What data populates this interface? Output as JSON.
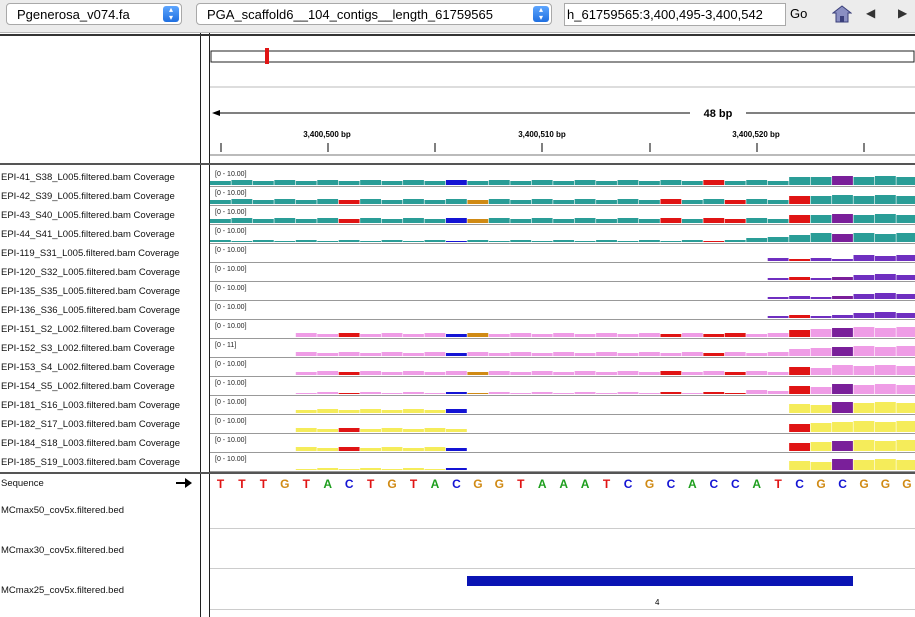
{
  "toolbar": {
    "genome": "Pgenerosa_v074.fa",
    "chromosome": "PGA_scaffold6__104_contigs__length_61759565",
    "locus": "h_61759565:3,400,495-3,400,542",
    "go_label": "Go",
    "home_icon": "home-icon",
    "back_icon": "back-arrow-icon",
    "forward_icon": "forward-arrow-icon"
  },
  "ruler": {
    "span_label": "48 bp",
    "ticks": [
      "3,400,500 bp",
      "3,400,510 bp",
      "3,400,520 bp"
    ]
  },
  "tracks": [
    {
      "label": "EPI-41_S38_L005.filtered.bam Coverage",
      "range": "[0 - 10.00]",
      "color": "#2a9d97"
    },
    {
      "label": "EPI-42_S39_L005.filtered.bam Coverage",
      "range": "[0 - 10.00]",
      "color": "#2a9d97"
    },
    {
      "label": "EPI-43_S40_L005.filtered.bam Coverage",
      "range": "[0 - 10.00]",
      "color": "#2a9d97"
    },
    {
      "label": "EPI-44_S41_L005.filtered.bam Coverage",
      "range": "[0 - 10.00]",
      "color": "#2a9d97"
    },
    {
      "label": "EPI-119_S31_L005.filtered.bam Coverage",
      "range": "[0 - 10.00]",
      "color": "#6f2fc0"
    },
    {
      "label": "EPI-120_S32_L005.filtered.bam Coverage",
      "range": "[0 - 10.00]",
      "color": "#6f2fc0"
    },
    {
      "label": "EPI-135_S35_L005.filtered.bam Coverage",
      "range": "[0 - 10.00]",
      "color": "#6f2fc0"
    },
    {
      "label": "EPI-136_S36_L005.filtered.bam Coverage",
      "range": "[0 - 10.00]",
      "color": "#6f2fc0"
    },
    {
      "label": "EPI-151_S2_L002.filtered.bam Coverage",
      "range": "[0 - 10.00]",
      "color": "#ef9ce6"
    },
    {
      "label": "EPI-152_S3_L002.filtered.bam Coverage",
      "range": "[0 - 11]",
      "color": "#ef9ce6"
    },
    {
      "label": "EPI-153_S4_L002.filtered.bam Coverage",
      "range": "[0 - 10.00]",
      "color": "#ef9ce6"
    },
    {
      "label": "EPI-154_S5_L002.filtered.bam Coverage",
      "range": "[0 - 10.00]",
      "color": "#ef9ce6"
    },
    {
      "label": "EPI-181_S16_L003.filtered.bam Coverage",
      "range": "[0 - 10.00]",
      "color": "#f5ec5a"
    },
    {
      "label": "EPI-182_S17_L003.filtered.bam Coverage",
      "range": "[0 - 10.00]",
      "color": "#f5ec5a"
    },
    {
      "label": "EPI-184_S18_L003.filtered.bam Coverage",
      "range": "[0 - 10.00]",
      "color": "#f5ec5a"
    },
    {
      "label": "EPI-185_S19_L003.filtered.bam Coverage",
      "range": "[0 - 10.00]",
      "color": "#f5ec5a"
    }
  ],
  "sequence": {
    "label": "Sequence",
    "strand_icon": "strand-arrow-icon",
    "bases": [
      "T",
      "T",
      "T",
      "G",
      "T",
      "A",
      "C",
      "T",
      "G",
      "T",
      "A",
      "C",
      "G",
      "G",
      "T",
      "A",
      "A",
      "A",
      "T",
      "C",
      "G",
      "C",
      "A",
      "C",
      "C",
      "A",
      "T",
      "C",
      "G",
      "C",
      "G",
      "G",
      "G"
    ]
  },
  "base_colors": {
    "A": "#1e9e1e",
    "C": "#1414d4",
    "G": "#d08a14",
    "T": "#e01414"
  },
  "bed_tracks": [
    {
      "label": "MCmax50_cov5x.filtered.bed"
    },
    {
      "label": "MCmax30_cov5x.filtered.bed"
    },
    {
      "label": "MCmax25_cov5x.filtered.bed",
      "feature_label": "4",
      "feature_color": "#0a14b4"
    }
  ]
}
